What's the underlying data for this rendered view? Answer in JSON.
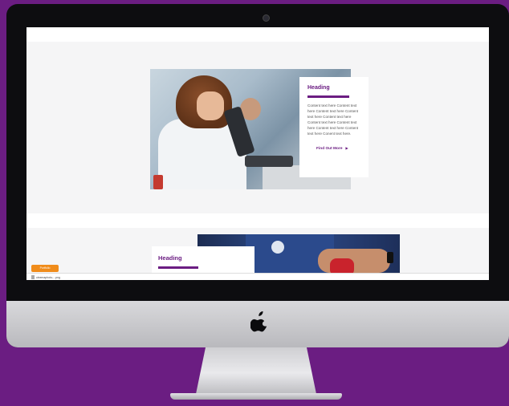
{
  "card1": {
    "heading": "Heading",
    "body": "Content text here Content text here Content text here Content text here Content text here Content text here Content text here Content text here Content text here Conent text here.",
    "cta": "Find Out More",
    "cta_icon": "triangle-right-icon"
  },
  "card2": {
    "heading": "Heading"
  },
  "screen_footer": {
    "tag_label": "Portfolio",
    "file_name": "cinemaphoto-...png"
  },
  "icons": {
    "camera": "camera-dot-icon",
    "logo": "apple-logo-icon"
  },
  "colors": {
    "background": "#6b1d82",
    "accent": "#6b1d82",
    "tag": "#f08c1b"
  }
}
